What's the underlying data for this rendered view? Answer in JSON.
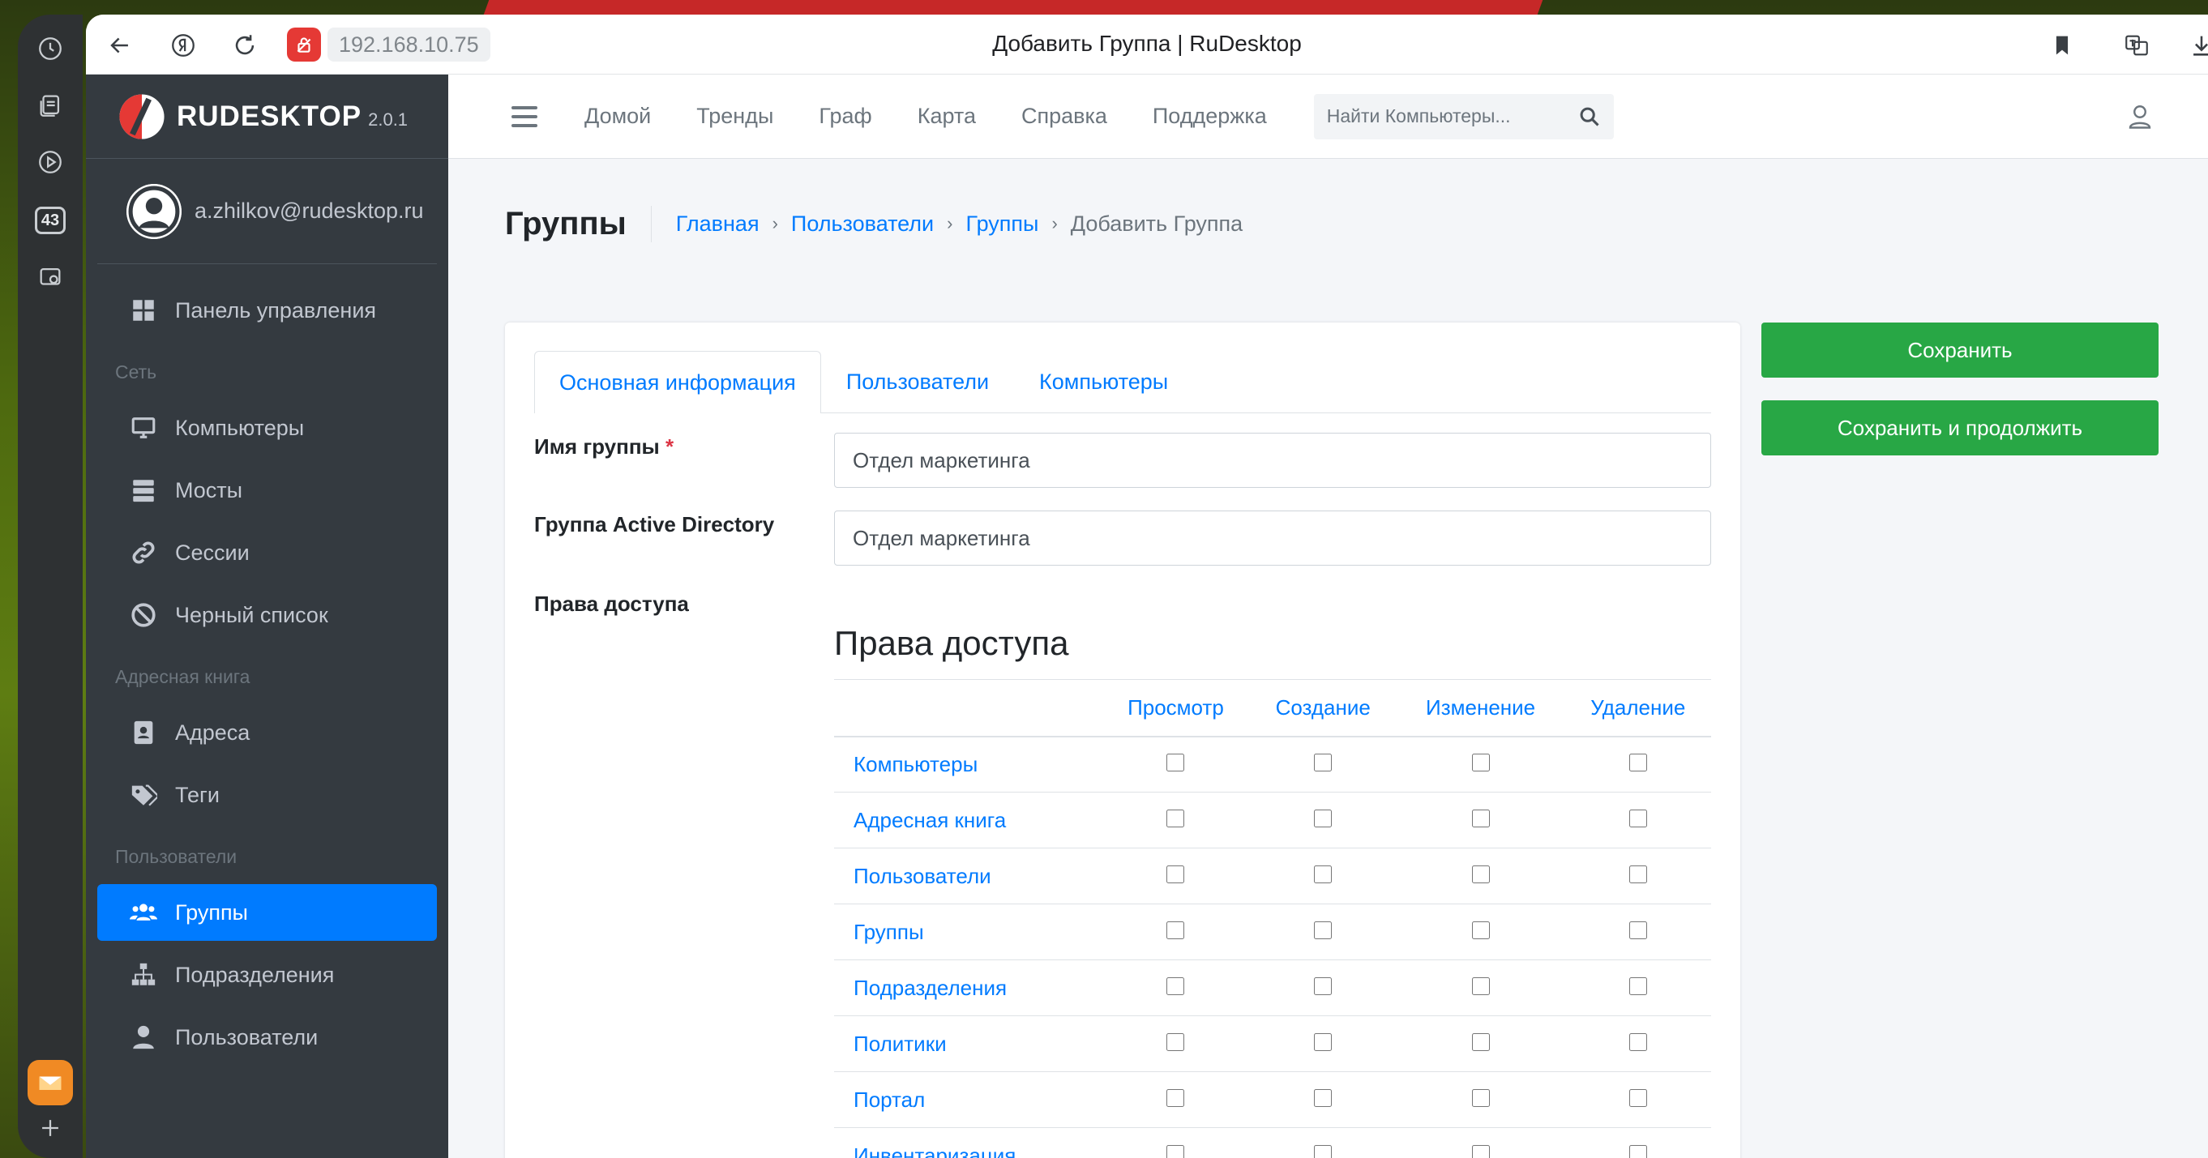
{
  "browser": {
    "url": "192.168.10.75",
    "tab_title": "Добавить Группа | RuDesktop",
    "rail_badge_count": "43"
  },
  "brand": {
    "name": "RUDESKTOP",
    "version": "2.0.1"
  },
  "user": {
    "email": "a.zhilkov@rudesktop.ru"
  },
  "sidebar": {
    "dashboard": "Панель управления",
    "sections": [
      {
        "header": "Сеть",
        "items": [
          "Компьютеры",
          "Мосты",
          "Сессии",
          "Черный список"
        ]
      },
      {
        "header": "Адресная книга",
        "items": [
          "Адреса",
          "Теги"
        ]
      },
      {
        "header": "Пользователи",
        "items": [
          "Группы",
          "Подразделения",
          "Пользователи"
        ]
      }
    ],
    "active_item": "Группы"
  },
  "navbar": {
    "links": [
      "Домой",
      "Тренды",
      "Граф",
      "Карта",
      "Справка",
      "Поддержка"
    ],
    "search_placeholder": "Найти Компьютеры..."
  },
  "page": {
    "title": "Группы",
    "breadcrumb": [
      "Главная",
      "Пользователи",
      "Группы"
    ],
    "breadcrumb_current": "Добавить Группа"
  },
  "tabs": [
    "Основная информация",
    "Пользователи",
    "Компьютеры"
  ],
  "form": {
    "group_name_label": "Имя группы",
    "group_name_value": "Отдел маркетинга",
    "ad_group_label": "Группа Active Directory",
    "ad_group_value": "Отдел маркетинга",
    "permissions_label": "Права доступа"
  },
  "permissions": {
    "title": "Права доступа",
    "columns": [
      "Просмотр",
      "Создание",
      "Изменение",
      "Удаление"
    ],
    "rows": [
      "Компьютеры",
      "Адресная книга",
      "Пользователи",
      "Группы",
      "Подразделения",
      "Политики",
      "Портал",
      "Инвентаризация"
    ]
  },
  "actions": {
    "save": "Сохранить",
    "save_continue": "Сохранить и продолжить"
  },
  "colors": {
    "sidebar_bg": "#343a40",
    "active_blue": "#007bff",
    "save_green": "#28a745"
  }
}
